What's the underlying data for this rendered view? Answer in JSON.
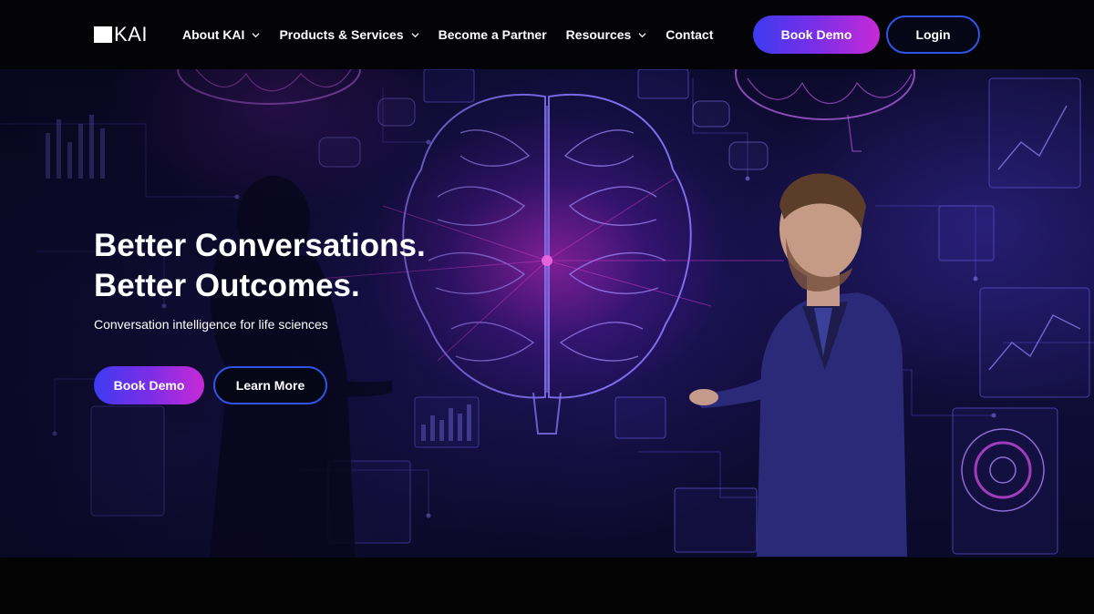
{
  "header": {
    "logo_text": "KAI",
    "nav": [
      {
        "label": "About KAI",
        "has_dropdown": true
      },
      {
        "label": "Products & Services",
        "has_dropdown": true
      },
      {
        "label": "Become a Partner",
        "has_dropdown": false
      },
      {
        "label": "Resources",
        "has_dropdown": true
      },
      {
        "label": "Contact",
        "has_dropdown": false
      }
    ],
    "book_demo_label": "Book Demo",
    "login_label": "Login"
  },
  "hero": {
    "title_line1": "Better Conversations.",
    "title_line2": "Better Outcomes.",
    "subtitle": "Conversation intelligence for life sciences",
    "primary_cta": "Book Demo",
    "secondary_cta": "Learn More"
  },
  "icons": {
    "logo": "kai-logo-mark",
    "dropdown": "chevron-down-icon"
  },
  "colors": {
    "page_background": "#030306",
    "button_gradient_start": "#3d3bf0",
    "button_gradient_end": "#c72ad6",
    "outline_border": "#3154e8",
    "accent_magenta": "#d628c8"
  }
}
